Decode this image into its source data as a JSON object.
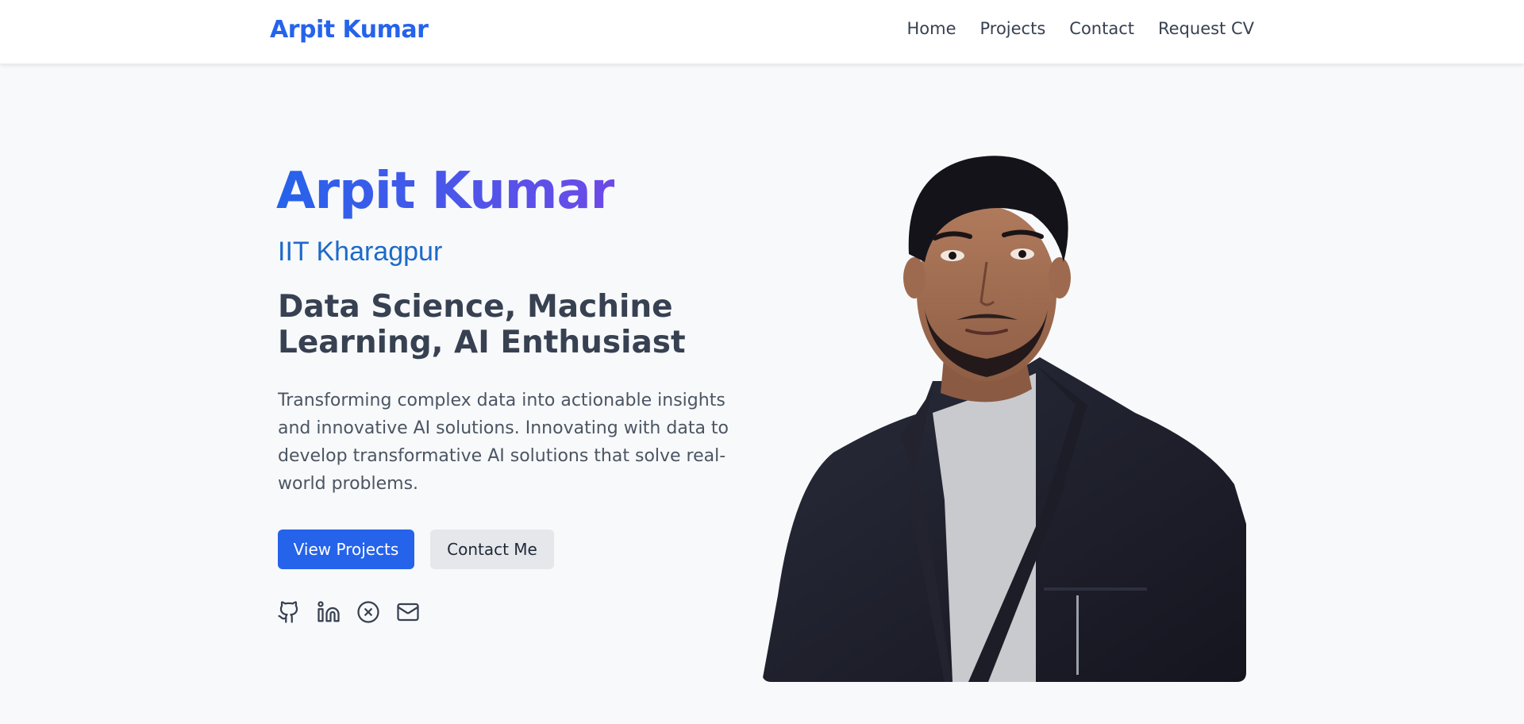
{
  "header": {
    "brand": "Arpit Kumar",
    "nav": [
      {
        "label": "Home"
      },
      {
        "label": "Projects"
      },
      {
        "label": "Contact"
      },
      {
        "label": "Request CV"
      }
    ]
  },
  "hero": {
    "name": "Arpit Kumar",
    "school": "IIT Kharagpur",
    "role": "Data Science, Machine Learning, AI Enthusiast",
    "description": "Transforming complex data into actionable insights and innovative AI solutions. Innovating with data to develop transformative AI solutions that solve real-world problems.",
    "primary_button": "View Projects",
    "secondary_button": "Contact Me",
    "socials": [
      {
        "icon": "github-icon"
      },
      {
        "icon": "linkedin-icon"
      },
      {
        "icon": "x-circle-icon"
      },
      {
        "icon": "mail-icon"
      }
    ]
  },
  "colors": {
    "accent": "#2563eb",
    "gradient_end": "#6d4ae8",
    "school": "#1d6ac9",
    "background": "#f8f9fb"
  }
}
